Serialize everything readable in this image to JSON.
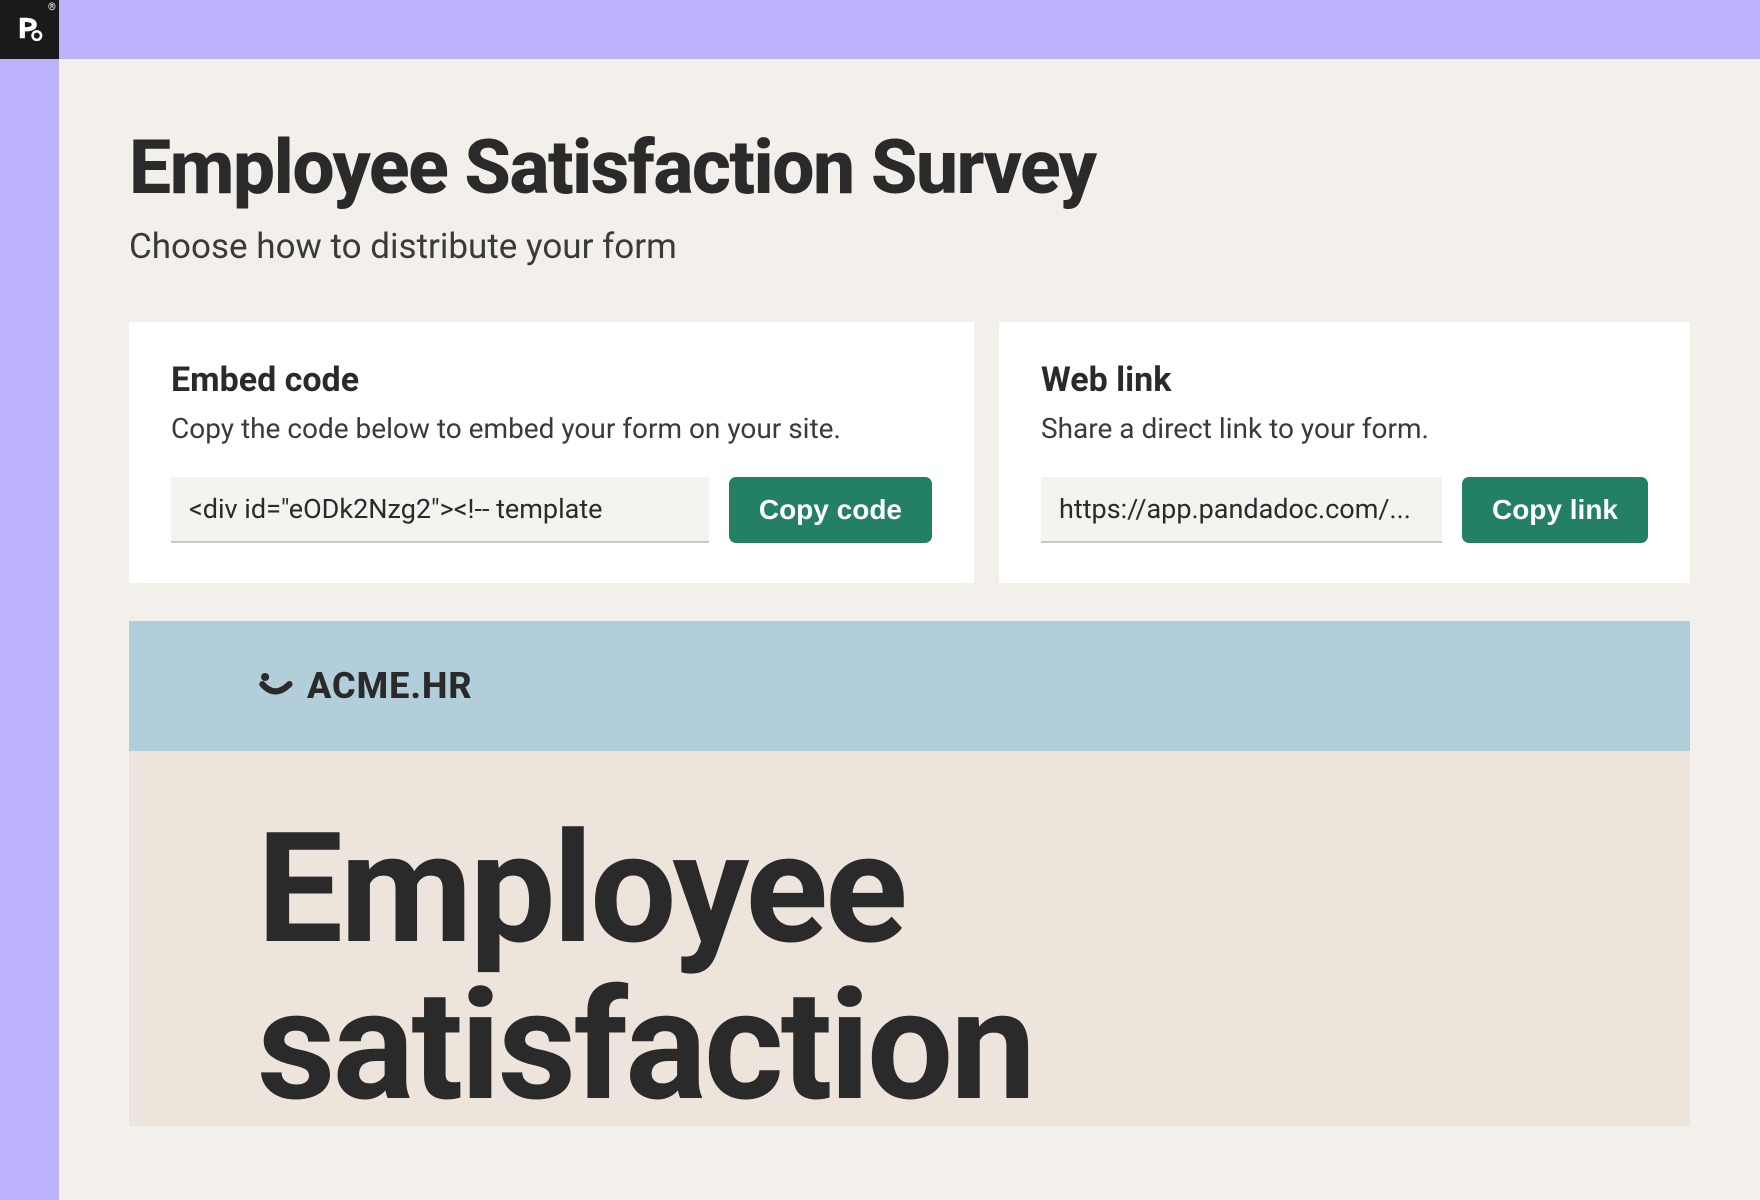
{
  "header": {
    "title": "Employee Satisfaction Survey",
    "subtitle": "Choose how to distribute your form"
  },
  "cards": {
    "embed": {
      "title": "Embed code",
      "description": "Copy the code below to embed your form on your site.",
      "code_value": "<div id=\"eODk2Nzg2\"><!-- template",
      "button_label": "Copy code"
    },
    "weblink": {
      "title": "Web link",
      "description": "Share a direct link to your form.",
      "link_value": "https://app.pandadoc.com/...",
      "button_label": "Copy link"
    }
  },
  "preview": {
    "brand": "ACME.HR",
    "title": "Employee satisfaction"
  },
  "colors": {
    "outer_bg": "#bdb2fc",
    "panel_bg": "#f3efea",
    "card_bg": "#ffffff",
    "code_bg": "#f3f3f0",
    "button_bg": "#248065",
    "preview_header_bg": "#b2cedb",
    "preview_body_bg": "#ede4db",
    "text_primary": "#2a2a2a"
  }
}
